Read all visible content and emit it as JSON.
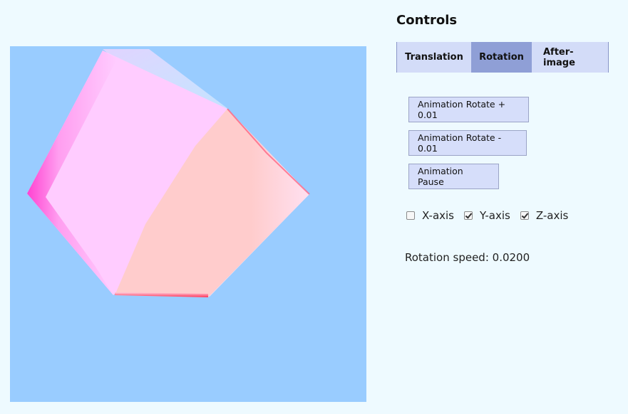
{
  "panel": {
    "title": "Controls",
    "tabs": [
      {
        "label": "Translation",
        "active": false
      },
      {
        "label": "Rotation",
        "active": true
      },
      {
        "label": "After-image",
        "active": false
      }
    ],
    "buttons": {
      "rotate_plus": "Animation Rotate + 0.01",
      "rotate_minus": "Animation Rotate - 0.01",
      "pause": "Animation Pause"
    },
    "axes": [
      {
        "label": "X-axis",
        "checked": false
      },
      {
        "label": "Y-axis",
        "checked": true
      },
      {
        "label": "Z-axis",
        "checked": true
      }
    ],
    "speed_label": "Rotation speed:",
    "speed_value": "0.0200"
  },
  "canvas": {
    "background": "#99ccff",
    "cube_colors": {
      "magenta_face": "#ffccff",
      "magenta_edge": "#ff33cc",
      "pink_face": "#ffcccc",
      "pink_edge": "#ff3366"
    }
  }
}
